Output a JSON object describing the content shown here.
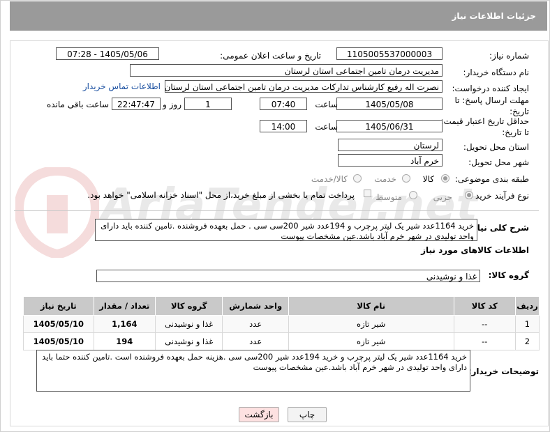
{
  "header": {
    "title": "جزئیات اطلاعات نیاز"
  },
  "fields": {
    "need_number_label": "شماره نیاز:",
    "need_number": "1105005537000003",
    "announce_label": "تاریخ و ساعت اعلان عمومی:",
    "announce_value": "1405/05/06 - 07:28",
    "buyer_org_label": "نام دستگاه خریدار:",
    "buyer_org": "مدیریت درمان تامین اجتماعی استان لرستان",
    "requester_label": "ایجاد کننده درخواست:",
    "requester": "نصرت اله رفیع کارشناس تدارکات مدیریت درمان تامین اجتماعی استان لرستان",
    "contact_link": "اطلاعات تماس خریدار",
    "reply_deadline_label": "مهلت ارسال پاسخ: تا تاریخ:",
    "reply_date": "1405/05/08",
    "time_label": "ساعت",
    "reply_time": "07:40",
    "days_value": "1",
    "days_label": "روز و",
    "remaining_time": "22:47:47",
    "remaining_label": "ساعت باقی مانده",
    "price_validity_label": "حداقل تاریخ اعتبار قیمت: تا تاریخ:",
    "price_date": "1405/06/31",
    "price_time": "14:00",
    "province_label": "استان محل تحویل:",
    "province": "لرستان",
    "city_label": "شهر محل تحویل:",
    "city": "خرم آباد",
    "category_label": "طبقه بندی موضوعی:",
    "category_options": [
      "کالا",
      "خدمت",
      "کالا/خدمت"
    ],
    "purchase_type_label": "نوع فرآیند خرید :",
    "purchase_options": [
      "جزیی",
      "متوسط"
    ],
    "payment_note": "پرداخت تمام یا بخشی از مبلغ خرید،از محل \"اسناد خزانه اسلامی\" خواهد بود.",
    "summary_label": "شرح کلی نیاز:",
    "summary": "خرید 1164عدد شیر یک لیتر پرچرب و  194عدد شیر 200سی سی . حمل بعهده فروشنده .تامین کننده  باید دارای واحد تولیدی در شهر خرم آباد باشد.عین مشخصات پیوست",
    "goods_info_title": "اطلاعات کالاهای مورد نیاز",
    "goods_group_label": "گروه کالا:",
    "goods_group": "غذا و نوشیدنی",
    "buyer_notes_label": "توضیحات خریدار:",
    "buyer_notes": "خرید 1164عدد شیر یک لیتر پرچرب و خرید 194عدد شیر 200سی سی .هزینه حمل بعهده فروشنده است .تامین کننده حتما باید دارای واحد تولیدی در شهر خرم آباد باشد.عین مشخصات پیوست"
  },
  "table": {
    "headers": [
      "ردیف",
      "کد کالا",
      "نام کالا",
      "واحد شمارش",
      "گروه کالا",
      "تعداد / مقدار",
      "تاریخ نیاز"
    ],
    "rows": [
      [
        "1",
        "--",
        "شیر تازه",
        "عدد",
        "غذا و نوشیدنی",
        "1,164",
        "1405/05/10"
      ],
      [
        "2",
        "--",
        "شیر تازه",
        "عدد",
        "غذا و نوشیدنی",
        "194",
        "1405/05/10"
      ]
    ]
  },
  "buttons": {
    "print": "چاپ",
    "back": "بازگشت"
  },
  "watermark": "AriaTender.net",
  "colors": {
    "header": "#9a9a9a",
    "link": "#1a4fa0",
    "back_button": "#fde1e1"
  }
}
